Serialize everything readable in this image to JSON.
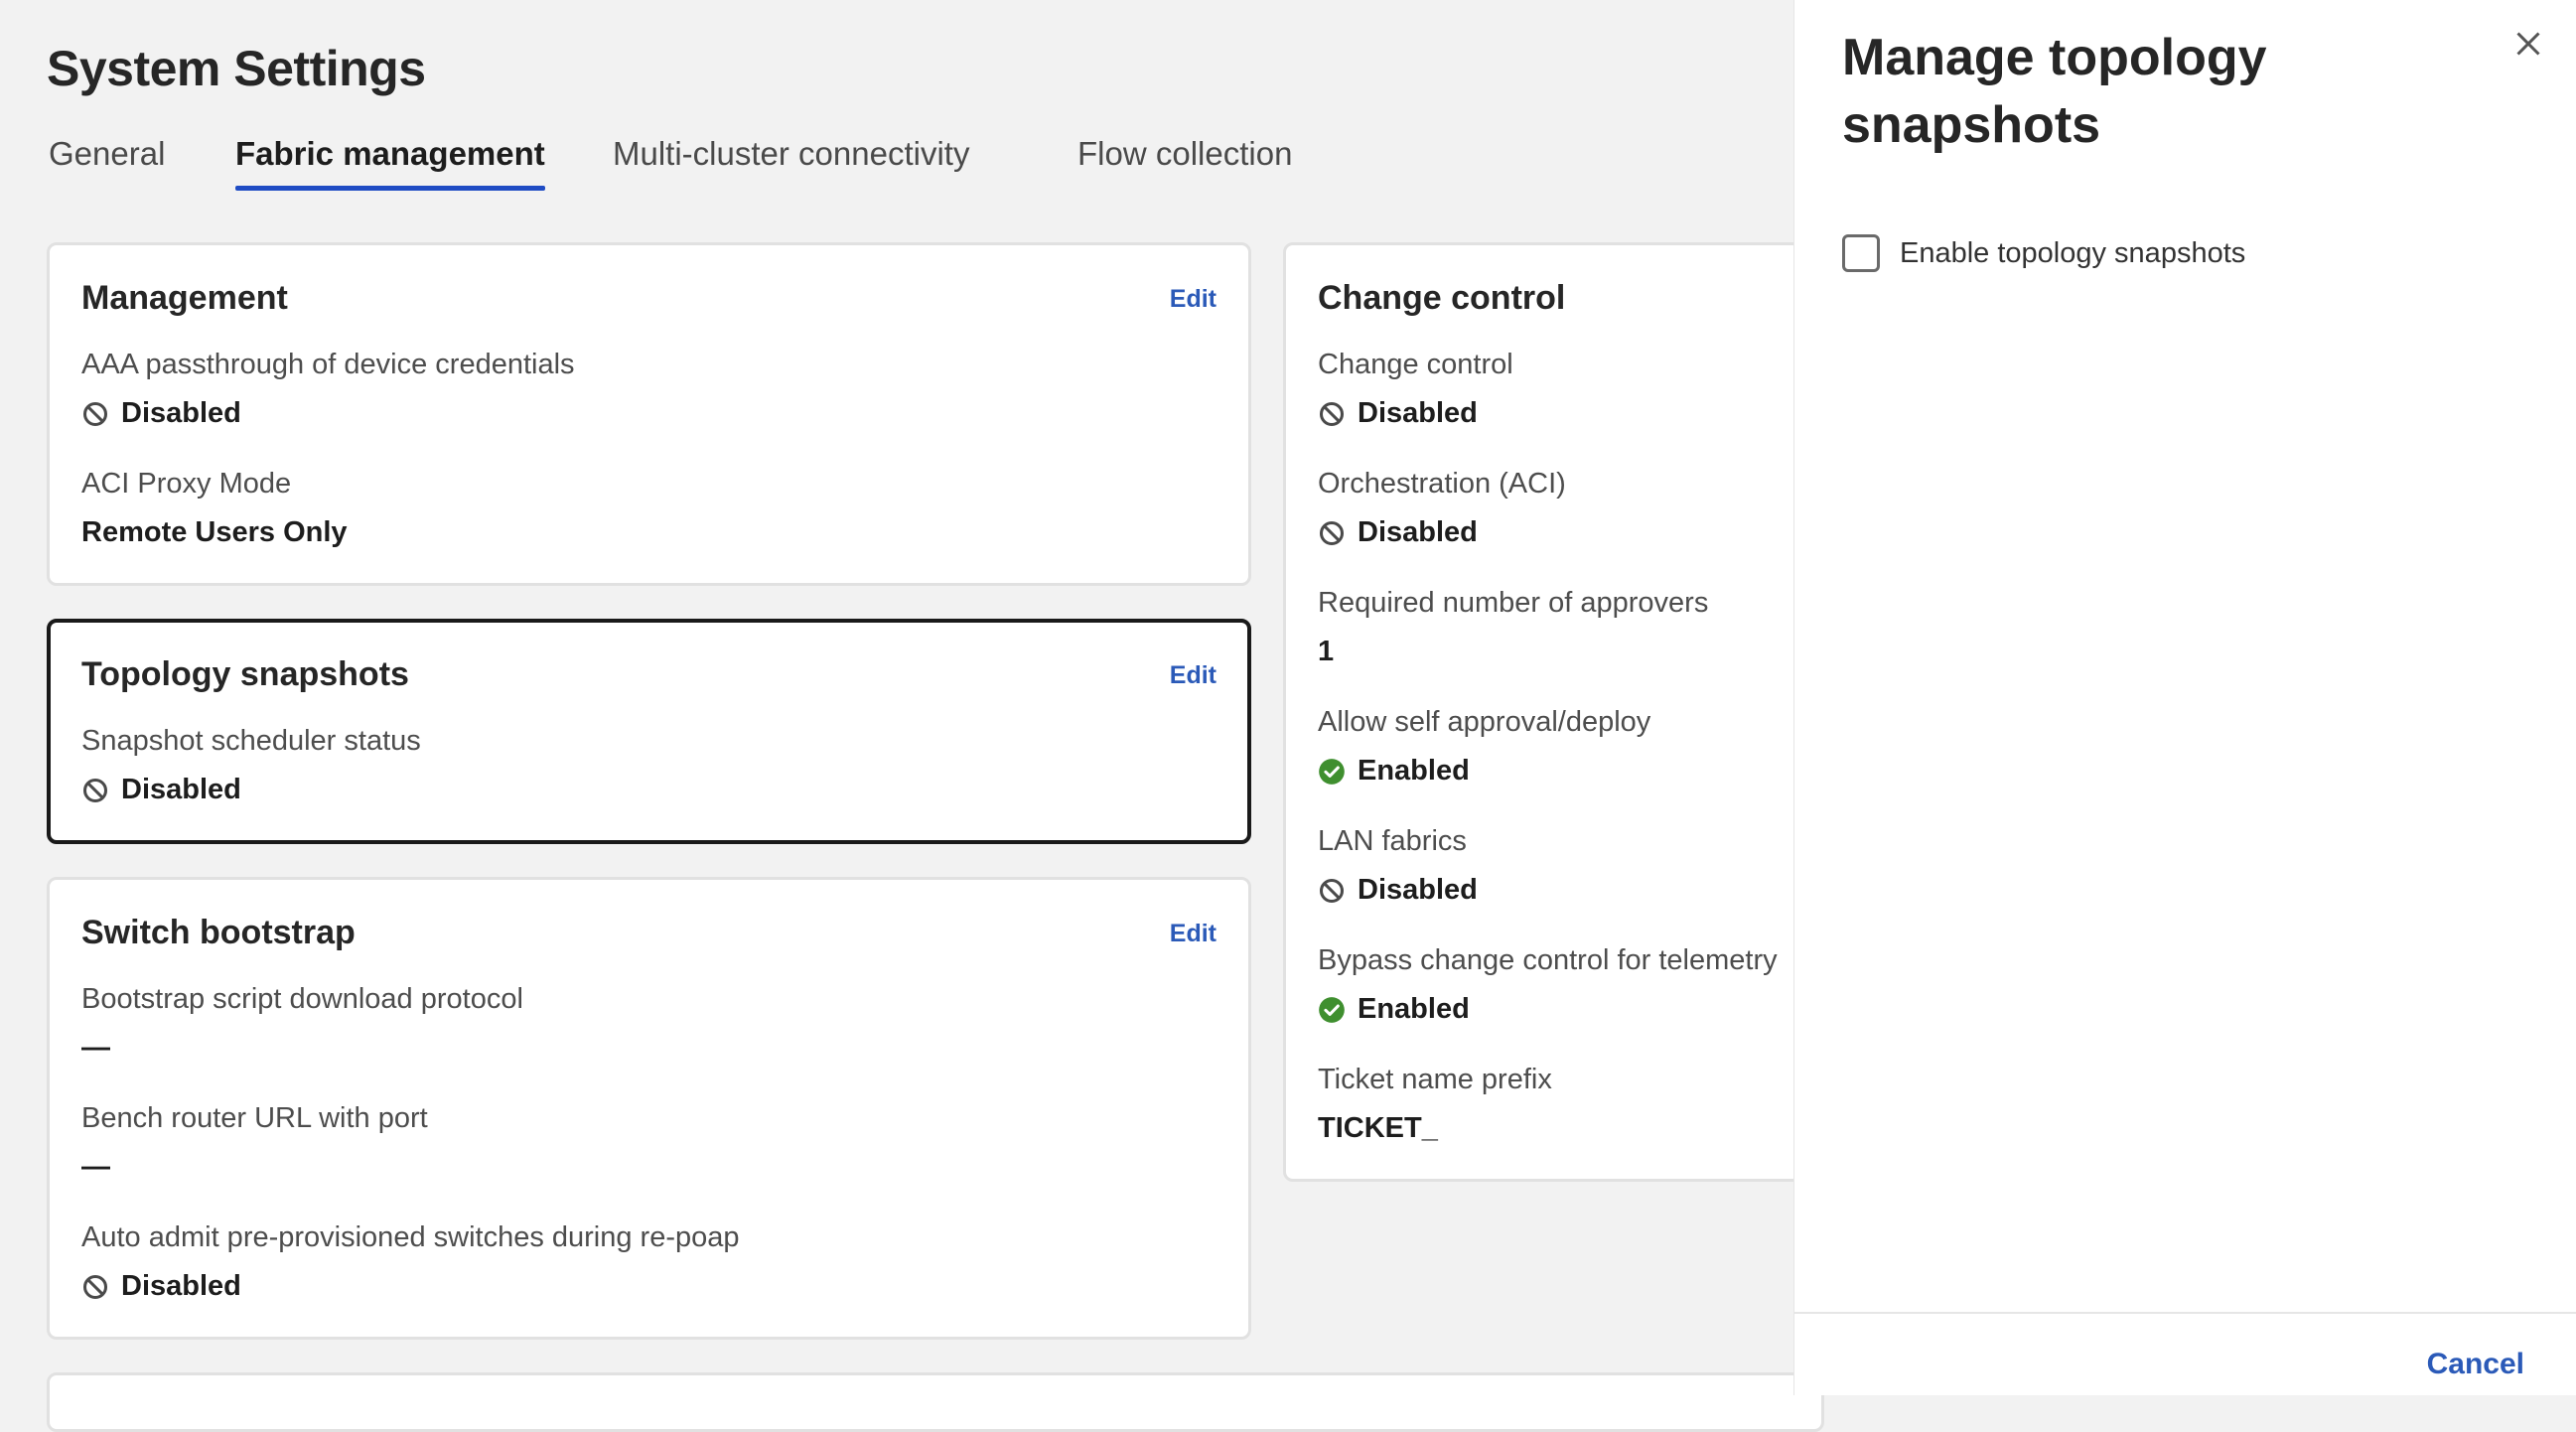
{
  "page": {
    "title": "System Settings",
    "tabs": [
      {
        "label": "General"
      },
      {
        "label": "Fabric management"
      },
      {
        "label": "Multi-cluster connectivity"
      },
      {
        "label": "Flow collection"
      }
    ],
    "active_tab": "Fabric management"
  },
  "cards": {
    "management": {
      "title": "Management",
      "edit": "Edit",
      "fields": [
        {
          "label": "AAA passthrough of device credentials",
          "value": "Disabled",
          "icon": "disabled-icon"
        },
        {
          "label": "ACI Proxy Mode",
          "value": "Remote Users Only"
        }
      ]
    },
    "topology": {
      "title": "Topology snapshots",
      "edit": "Edit",
      "fields": [
        {
          "label": "Snapshot scheduler status",
          "value": "Disabled",
          "icon": "disabled-icon"
        }
      ]
    },
    "bootstrap": {
      "title": "Switch bootstrap",
      "edit": "Edit",
      "fields": [
        {
          "label": "Bootstrap script download protocol",
          "value": "—"
        },
        {
          "label": "Bench router URL with port",
          "value": "—"
        },
        {
          "label": "Auto admit pre-provisioned switches during re-poap",
          "value": "Disabled",
          "icon": "disabled-icon"
        }
      ]
    },
    "change_control": {
      "title": "Change control",
      "fields": [
        {
          "label": "Change control",
          "value": "Disabled",
          "icon": "disabled-icon"
        },
        {
          "label": "Orchestration (ACI)",
          "value": "Disabled",
          "icon": "disabled-icon"
        },
        {
          "label": "Required number of approvers",
          "value": "1"
        },
        {
          "label": "Allow self approval/deploy",
          "value": "Enabled",
          "icon": "enabled-icon"
        },
        {
          "label": "LAN fabrics",
          "value": "Disabled",
          "icon": "disabled-icon"
        },
        {
          "label": "Bypass change control for telemetry",
          "value": "Enabled",
          "icon": "enabled-icon"
        },
        {
          "label": "Ticket name prefix",
          "value": "TICKET_"
        }
      ]
    }
  },
  "panel": {
    "title": "Manage topology snapshots",
    "checkbox_label": "Enable topology snapshots",
    "checkbox_checked": false,
    "cancel": "Cancel"
  },
  "colors": {
    "accent": "#1f4cc4",
    "link": "#2b5ab8",
    "enabled": "#3f8f2f",
    "disabled_icon": "#4a4a4a"
  }
}
